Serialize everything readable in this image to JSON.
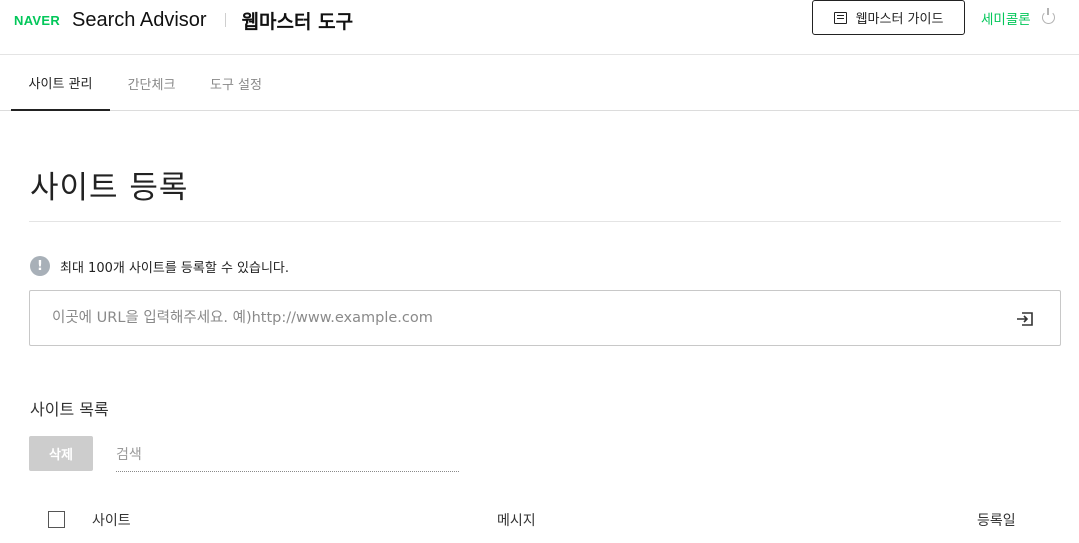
{
  "header": {
    "logo": "NAVER",
    "product": "Search Advisor",
    "tool_title": "웹마스터 도구",
    "guide_button": "웹마스터 가이드",
    "user_name": "세미콜론"
  },
  "tabs": [
    {
      "label": "사이트 관리",
      "active": true
    },
    {
      "label": "간단체크",
      "active": false
    },
    {
      "label": "도구 설정",
      "active": false
    }
  ],
  "main": {
    "title": "사이트 등록",
    "notice": "최대 100개 사이트를 등록할 수 있습니다.",
    "url_input": {
      "value": "",
      "placeholder": "이곳에 URL을 입력해주세요. 예)http://www.example.com"
    },
    "list_title": "사이트 목록",
    "delete_button": "삭제",
    "search": {
      "value": "",
      "placeholder": "검색"
    },
    "table_columns": [
      "사이트",
      "메시지",
      "등록일"
    ]
  },
  "colors": {
    "brand": "#03c75a",
    "disabled_button": "#cdcdcd",
    "info_icon": "#a8b0b8"
  },
  "icons": {
    "guide": "document-list-icon",
    "logout": "power-icon",
    "notice": "info-icon",
    "submit": "enter-icon"
  }
}
